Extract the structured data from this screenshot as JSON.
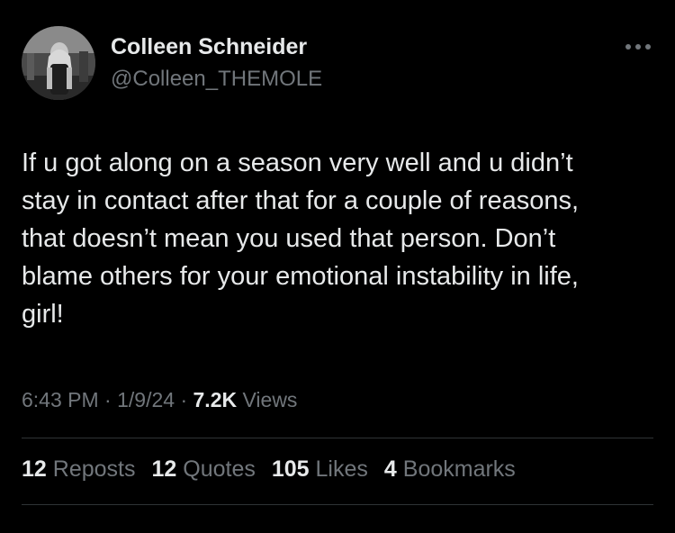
{
  "author": {
    "display_name": "Colleen Schneider",
    "handle": "@Colleen_THEMOLE",
    "avatar_icon": "user-avatar-photo"
  },
  "more_icon": "more-horizontal-icon",
  "tweet": {
    "text": "If u got along on a season very well and u didn’t\nstay in contact after that for a couple of reasons,\nthat doesn’t mean you used that person. Don’t\nblame others for your emotional instability in life,\ngirl!"
  },
  "meta": {
    "time": "6:43 PM",
    "sep1": " · ",
    "date": "1/9/24",
    "sep2": " · ",
    "views_count": "7.2K",
    "views_label": " Views"
  },
  "stats": {
    "reposts": {
      "count": "12",
      "label": "Reposts"
    },
    "quotes": {
      "count": "12",
      "label": "Quotes"
    },
    "likes": {
      "count": "105",
      "label": "Likes"
    },
    "bookmarks": {
      "count": "4",
      "label": "Bookmarks"
    }
  },
  "colors": {
    "background": "#000000",
    "primary_text": "#e7e9ea",
    "secondary_text": "#71767b",
    "divider": "#2f3336"
  }
}
